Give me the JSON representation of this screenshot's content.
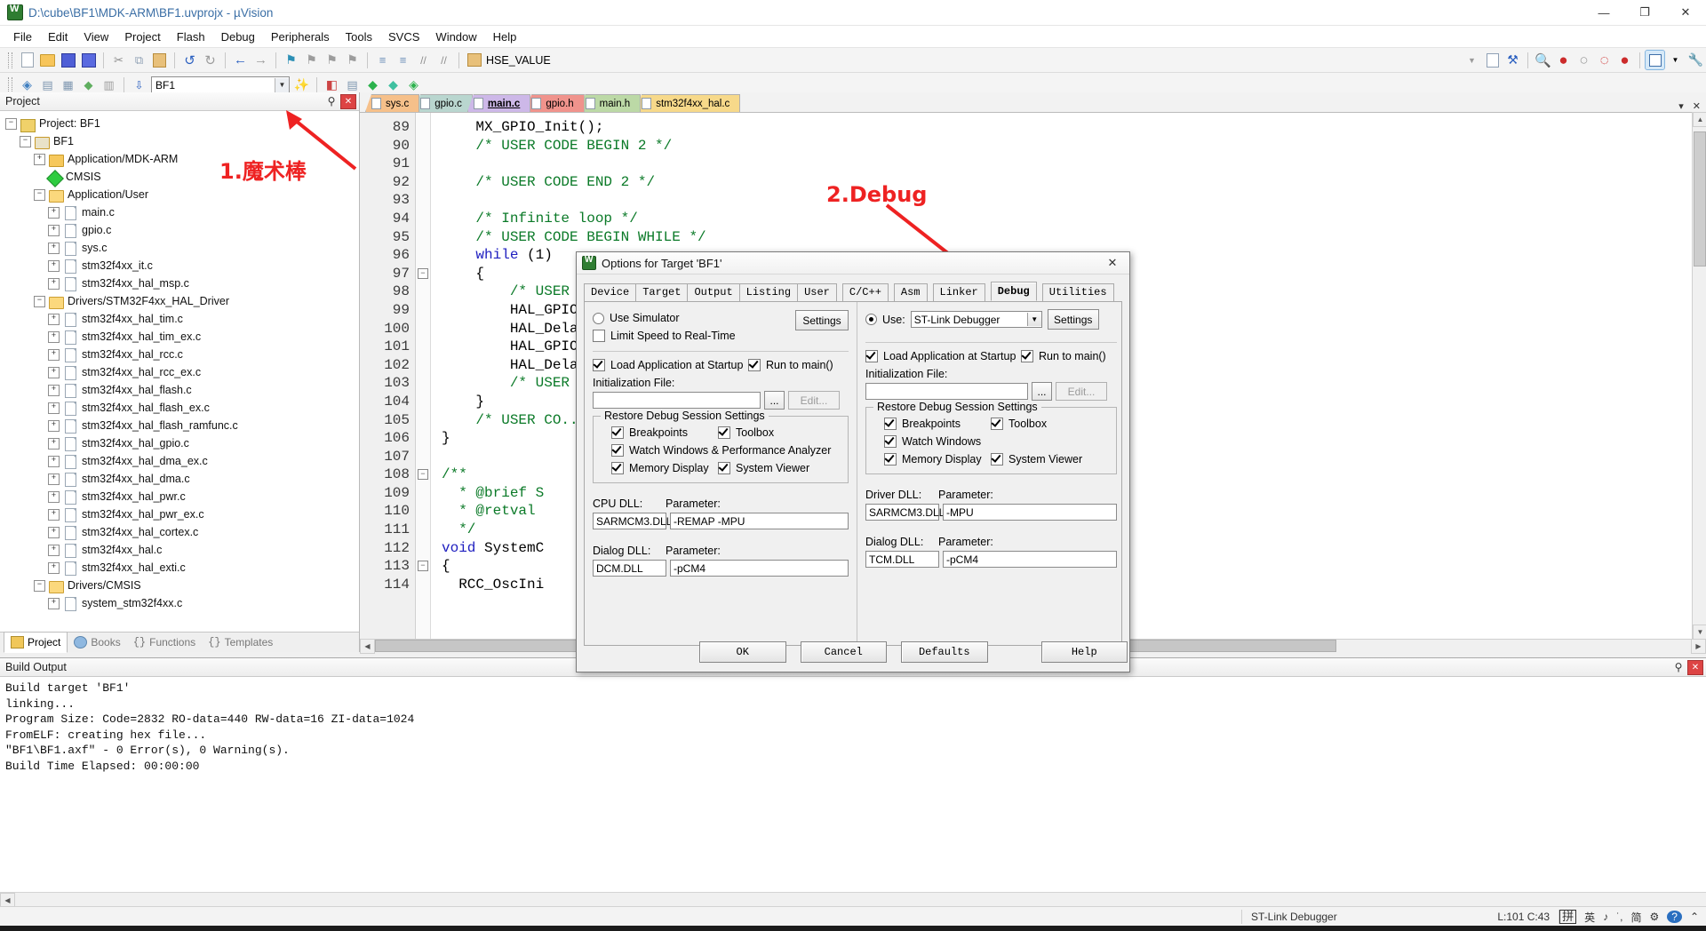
{
  "window": {
    "title": "D:\\cube\\BF1\\MDK-ARM\\BF1.uvprojx - µVision",
    "minimize": "—",
    "maximize": "❐",
    "close": "✕"
  },
  "menu": [
    "File",
    "Edit",
    "View",
    "Project",
    "Flash",
    "Debug",
    "Peripherals",
    "Tools",
    "SVCS",
    "Window",
    "Help"
  ],
  "toolbar2": {
    "target_combo": "BF1",
    "define_combo": "HSE_VALUE"
  },
  "project_pane": {
    "title": "Project",
    "pin": "⚲",
    "close": "✕",
    "tree": [
      {
        "depth": 0,
        "exp": "−",
        "icon": "project-icon",
        "label": "Project: BF1"
      },
      {
        "depth": 1,
        "exp": "−",
        "icon": "target-icon",
        "label": "BF1"
      },
      {
        "depth": 2,
        "exp": "+",
        "icon": "folder-icon",
        "label": "Application/MDK-ARM"
      },
      {
        "depth": 2,
        "exp": "",
        "icon": "cmsis-icon",
        "label": "CMSIS"
      },
      {
        "depth": 2,
        "exp": "−",
        "icon": "folder-open-icon",
        "label": "Application/User"
      },
      {
        "depth": 3,
        "exp": "+",
        "icon": "file-icon",
        "label": "main.c"
      },
      {
        "depth": 3,
        "exp": "+",
        "icon": "file-icon",
        "label": "gpio.c"
      },
      {
        "depth": 3,
        "exp": "+",
        "icon": "file-icon",
        "label": "sys.c"
      },
      {
        "depth": 3,
        "exp": "+",
        "icon": "file-icon",
        "label": "stm32f4xx_it.c"
      },
      {
        "depth": 3,
        "exp": "+",
        "icon": "file-icon",
        "label": "stm32f4xx_hal_msp.c"
      },
      {
        "depth": 2,
        "exp": "−",
        "icon": "folder-open-icon",
        "label": "Drivers/STM32F4xx_HAL_Driver"
      },
      {
        "depth": 3,
        "exp": "+",
        "icon": "file-icon",
        "label": "stm32f4xx_hal_tim.c"
      },
      {
        "depth": 3,
        "exp": "+",
        "icon": "file-icon",
        "label": "stm32f4xx_hal_tim_ex.c"
      },
      {
        "depth": 3,
        "exp": "+",
        "icon": "file-icon",
        "label": "stm32f4xx_hal_rcc.c"
      },
      {
        "depth": 3,
        "exp": "+",
        "icon": "file-icon",
        "label": "stm32f4xx_hal_rcc_ex.c"
      },
      {
        "depth": 3,
        "exp": "+",
        "icon": "file-icon",
        "label": "stm32f4xx_hal_flash.c"
      },
      {
        "depth": 3,
        "exp": "+",
        "icon": "file-icon",
        "label": "stm32f4xx_hal_flash_ex.c"
      },
      {
        "depth": 3,
        "exp": "+",
        "icon": "file-icon",
        "label": "stm32f4xx_hal_flash_ramfunc.c"
      },
      {
        "depth": 3,
        "exp": "+",
        "icon": "file-icon",
        "label": "stm32f4xx_hal_gpio.c"
      },
      {
        "depth": 3,
        "exp": "+",
        "icon": "file-icon",
        "label": "stm32f4xx_hal_dma_ex.c"
      },
      {
        "depth": 3,
        "exp": "+",
        "icon": "file-icon",
        "label": "stm32f4xx_hal_dma.c"
      },
      {
        "depth": 3,
        "exp": "+",
        "icon": "file-icon",
        "label": "stm32f4xx_hal_pwr.c"
      },
      {
        "depth": 3,
        "exp": "+",
        "icon": "file-icon",
        "label": "stm32f4xx_hal_pwr_ex.c"
      },
      {
        "depth": 3,
        "exp": "+",
        "icon": "file-icon",
        "label": "stm32f4xx_hal_cortex.c"
      },
      {
        "depth": 3,
        "exp": "+",
        "icon": "file-icon",
        "label": "stm32f4xx_hal.c"
      },
      {
        "depth": 3,
        "exp": "+",
        "icon": "file-icon",
        "label": "stm32f4xx_hal_exti.c"
      },
      {
        "depth": 2,
        "exp": "−",
        "icon": "folder-open-icon",
        "label": "Drivers/CMSIS"
      },
      {
        "depth": 3,
        "exp": "+",
        "icon": "file-icon",
        "label": "system_stm32f4xx.c"
      }
    ],
    "bottom_tabs": [
      {
        "label": "Project",
        "active": true
      },
      {
        "label": "Books",
        "active": false
      },
      {
        "label": "Functions",
        "active": false,
        "prefix": "{}"
      },
      {
        "label": "Templates",
        "active": false,
        "prefix": "{}"
      }
    ]
  },
  "editor": {
    "tabs": [
      {
        "label": "sys.c",
        "active": false,
        "color": "#f6c08a"
      },
      {
        "label": "gpio.c",
        "active": false,
        "color": "#b9d6cf"
      },
      {
        "label": "main.c",
        "active": true,
        "color": "#cdb8e8"
      },
      {
        "label": "gpio.h",
        "active": false,
        "color": "#f0938c"
      },
      {
        "label": "main.h",
        "active": false,
        "color": "#bcd9a6"
      },
      {
        "label": "stm32f4xx_hal.c",
        "active": false,
        "color": "#f7d98a"
      }
    ],
    "collapse_icon": "▾",
    "close_icon": "✕",
    "first_line": 89,
    "lines": [
      {
        "n": 89,
        "fold": "",
        "text": "    MX_GPIO_Init();",
        "style": "plain"
      },
      {
        "n": 90,
        "fold": "",
        "text": "    /* USER CODE BEGIN 2 */",
        "style": "comment"
      },
      {
        "n": 91,
        "fold": "",
        "text": "",
        "style": "plain"
      },
      {
        "n": 92,
        "fold": "",
        "text": "    /* USER CODE END 2 */",
        "style": "comment"
      },
      {
        "n": 93,
        "fold": "",
        "text": "",
        "style": "plain"
      },
      {
        "n": 94,
        "fold": "",
        "text": "    /* Infinite loop */",
        "style": "comment"
      },
      {
        "n": 95,
        "fold": "",
        "text": "    /* USER CODE BEGIN WHILE */",
        "style": "comment"
      },
      {
        "n": 96,
        "fold": "",
        "text": "    while (1)",
        "style": "keyword-while"
      },
      {
        "n": 97,
        "fold": "−",
        "text": "    {",
        "style": "plain"
      },
      {
        "n": 98,
        "fold": "",
        "text": "        /* USER CODE ...",
        "style": "comment"
      },
      {
        "n": 99,
        "fold": "",
        "text": "        HAL_GPIO...",
        "style": "plain"
      },
      {
        "n": 100,
        "fold": "",
        "text": "        HAL_Dela...",
        "style": "plain"
      },
      {
        "n": 101,
        "fold": "",
        "text": "        HAL_GPIO...",
        "style": "plain"
      },
      {
        "n": 102,
        "fold": "",
        "text": "        HAL_Dela...",
        "style": "plain"
      },
      {
        "n": 103,
        "fold": "",
        "text": "        /* USER ...",
        "style": "comment"
      },
      {
        "n": 104,
        "fold": "",
        "text": "    }",
        "style": "plain"
      },
      {
        "n": 105,
        "fold": "",
        "text": "    /* USER CO...",
        "style": "comment"
      },
      {
        "n": 106,
        "fold": "",
        "text": "}",
        "style": "plain"
      },
      {
        "n": 107,
        "fold": "",
        "text": "",
        "style": "plain"
      },
      {
        "n": 108,
        "fold": "−",
        "text": "/**",
        "style": "comment"
      },
      {
        "n": 109,
        "fold": "",
        "text": "  * @brief S",
        "style": "comment"
      },
      {
        "n": 110,
        "fold": "",
        "text": "  * @retval ",
        "style": "comment"
      },
      {
        "n": 111,
        "fold": "",
        "text": "  */",
        "style": "comment"
      },
      {
        "n": 112,
        "fold": "",
        "text": "void SystemC",
        "style": "keyword-void"
      },
      {
        "n": 113,
        "fold": "−",
        "text": "{",
        "style": "plain"
      },
      {
        "n": 114,
        "fold": "",
        "text": "  RCC_OscIni",
        "style": "plain"
      }
    ]
  },
  "annotations": [
    {
      "id": "magic-wand",
      "text": "1.魔术棒"
    },
    {
      "id": "debug",
      "text": "2.Debug"
    }
  ],
  "build_output": {
    "title": "Build Output",
    "lines": [
      "Build target 'BF1'",
      "linking...",
      "Program Size: Code=2832 RO-data=440 RW-data=16 ZI-data=1024",
      "FromELF: creating hex file...",
      "\"BF1\\BF1.axf\" - 0 Error(s), 0 Warning(s).",
      "Build Time Elapsed:  00:00:00"
    ]
  },
  "status_bar": {
    "debugger": "ST-Link Debugger",
    "cursor": "L:101 C:43",
    "ime": [
      "拼",
      "英",
      "♪",
      "˙,",
      "简",
      "⚙",
      "?",
      "⌃"
    ]
  },
  "dialog": {
    "title": "Options for Target 'BF1'",
    "close": "✕",
    "tabs": [
      {
        "label": "Device",
        "active": false
      },
      {
        "label": "Target",
        "active": false
      },
      {
        "label": "Output",
        "active": false
      },
      {
        "label": "Listing",
        "active": false
      },
      {
        "label": "User",
        "active": false
      },
      {
        "label": "C/C++",
        "active": false
      },
      {
        "label": "Asm",
        "active": false
      },
      {
        "label": "Linker",
        "active": false
      },
      {
        "label": "Debug",
        "active": true
      },
      {
        "label": "Utilities",
        "active": false
      }
    ],
    "left": {
      "use_simulator": {
        "label": "Use Simulator",
        "checked": false
      },
      "limit_speed": {
        "label": "Limit Speed to Real-Time",
        "checked": false
      },
      "settings_button": "Settings",
      "load_app": {
        "label": "Load Application at Startup",
        "checked": true
      },
      "run_to_main": {
        "label": "Run to main()",
        "checked": true
      },
      "init_file_label": "Initialization File:",
      "init_file_value": "",
      "browse_button": "...",
      "edit_button": "Edit...",
      "restore_group": "Restore Debug Session Settings",
      "restore_items": [
        {
          "label": "Breakpoints",
          "checked": true
        },
        {
          "label": "Toolbox",
          "checked": true
        },
        {
          "label": "Watch Windows & Performance Analyzer",
          "checked": true
        },
        {
          "label": "Memory Display",
          "checked": true
        },
        {
          "label": "System Viewer",
          "checked": true
        }
      ],
      "cpu_dll_label": "CPU DLL:",
      "cpu_dll_value": "SARMCM3.DLL",
      "cpu_param_label": "Parameter:",
      "cpu_param_value": "-REMAP -MPU",
      "dialog_dll_label": "Dialog DLL:",
      "dialog_dll_value": "DCM.DLL",
      "dialog_param_label": "Parameter:",
      "dialog_param_value": "-pCM4"
    },
    "right": {
      "use_radio": {
        "label": "Use:",
        "checked": true
      },
      "debugger_select": "ST-Link Debugger",
      "settings_button": "Settings",
      "load_app": {
        "label": "Load Application at Startup",
        "checked": true
      },
      "run_to_main": {
        "label": "Run to main()",
        "checked": true
      },
      "init_file_label": "Initialization File:",
      "init_file_value": "",
      "browse_button": "...",
      "edit_button": "Edit...",
      "restore_group": "Restore Debug Session Settings",
      "restore_items": [
        {
          "label": "Breakpoints",
          "checked": true
        },
        {
          "label": "Toolbox",
          "checked": true
        },
        {
          "label": "Watch Windows",
          "checked": true
        },
        {
          "label": "Memory Display",
          "checked": true
        },
        {
          "label": "System Viewer",
          "checked": true
        }
      ],
      "driver_dll_label": "Driver DLL:",
      "driver_dll_value": "SARMCM3.DLL",
      "driver_param_label": "Parameter:",
      "driver_param_value": "-MPU",
      "dialog_dll_label": "Dialog DLL:",
      "dialog_dll_value": "TCM.DLL",
      "dialog_param_label": "Parameter:",
      "dialog_param_value": "-pCM4"
    },
    "buttons": {
      "ok": "OK",
      "cancel": "Cancel",
      "defaults": "Defaults",
      "help": "Help"
    }
  }
}
